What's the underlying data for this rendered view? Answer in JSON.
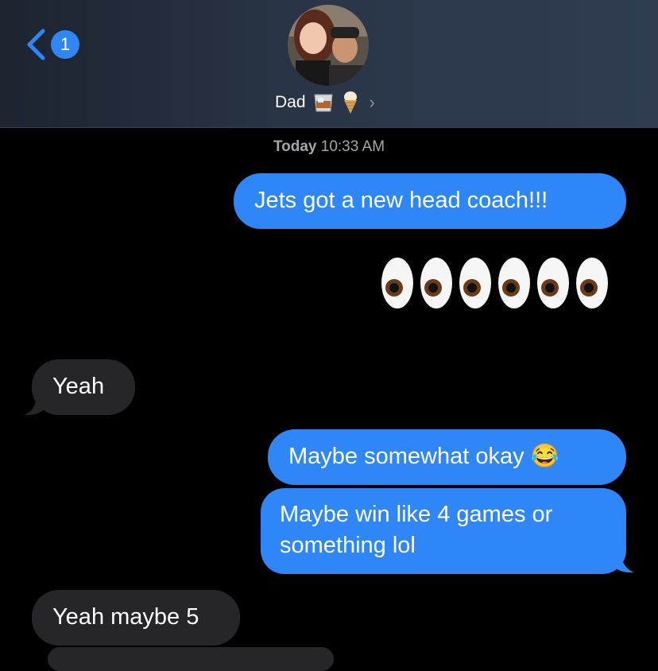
{
  "header": {
    "back_count": "1",
    "contact_name": "Dad",
    "contact_emojis": [
      "whiskey-glass",
      "ice-cream-cone"
    ]
  },
  "thread": {
    "timestamp_day": "Today",
    "timestamp_time": "10:33 AM",
    "messages": [
      {
        "from": "me",
        "text": "Jets got a new head coach!!!"
      },
      {
        "from": "me",
        "text": "👀👀👀",
        "kind": "emoji"
      },
      {
        "from": "them",
        "text": "Yeah"
      },
      {
        "from": "me",
        "text": "Maybe somewhat okay 😂"
      },
      {
        "from": "me",
        "text": "Maybe win like 4 games or something lol"
      },
      {
        "from": "them",
        "text": "Yeah maybe 5"
      }
    ]
  },
  "colors": {
    "sent_bubble": "#2f86f6",
    "received_bubble": "#262629",
    "background": "#000000",
    "accent": "#2f86f6"
  }
}
